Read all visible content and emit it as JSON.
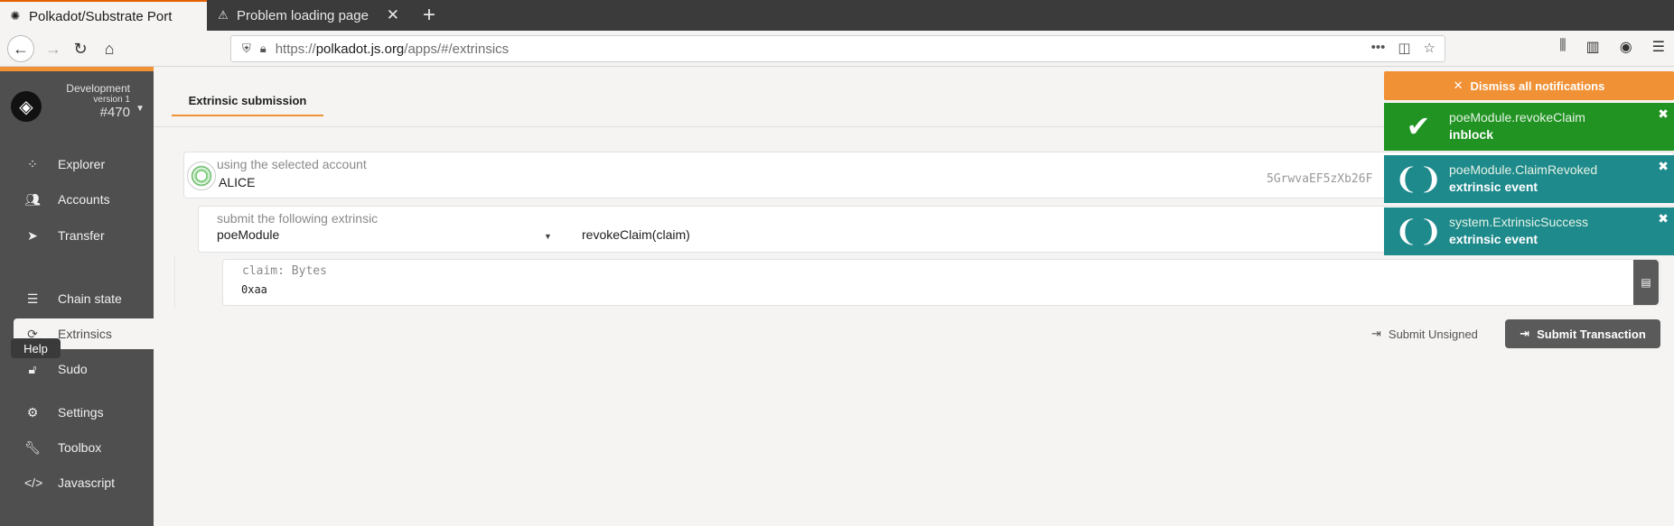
{
  "browser": {
    "tabs": [
      {
        "title": "Polkadot/Substrate Port",
        "icon": "polkadot-favicon",
        "active": true
      },
      {
        "title": "Problem loading page",
        "icon": "warning-icon",
        "active": false
      }
    ],
    "url": {
      "host_prefix": "https://",
      "host": "polkadot.js.org",
      "path": "/apps/#/extrinsics"
    }
  },
  "sidebar": {
    "chain": {
      "name": "Development",
      "version": "version 1",
      "block": "#470"
    },
    "items": [
      {
        "label": "Explorer",
        "icon": "explorer-icon"
      },
      {
        "label": "Accounts",
        "icon": "users-icon"
      },
      {
        "label": "Transfer",
        "icon": "send-icon"
      },
      {
        "label": "Chain state",
        "icon": "database-icon"
      },
      {
        "label": "Extrinsics",
        "icon": "sync-icon"
      },
      {
        "label": "Sudo",
        "icon": "unlock-icon"
      },
      {
        "label": "Settings",
        "icon": "cogs-icon"
      },
      {
        "label": "Toolbox",
        "icon": "wrench-icon"
      },
      {
        "label": "Javascript",
        "icon": "code-icon"
      }
    ],
    "active_item": "Extrinsics",
    "help_tooltip": "Help"
  },
  "main": {
    "tab": "Extrinsic submission",
    "account": {
      "label": "using the selected account",
      "name": "ALICE",
      "address": "5GrwvaEF5zXb26F"
    },
    "extrinsic": {
      "label": "submit the following extrinsic",
      "module": "poeModule",
      "method": "revokeClaim(claim)"
    },
    "param": {
      "label": "claim: Bytes",
      "value": "0xaa"
    },
    "buttons": {
      "unsigned": "Submit Unsigned",
      "submit": "Submit Transaction"
    }
  },
  "notifications": {
    "dismiss_label": "Dismiss all notifications",
    "items": [
      {
        "title": "poeModule.revokeClaim",
        "status": "inblock",
        "color": "#219322",
        "icon": "check-icon"
      },
      {
        "title": "poeModule.ClaimRevoked",
        "status": "extrinsic event",
        "color": "#1e8a8c",
        "icon": "listening-icon"
      },
      {
        "title": "system.ExtrinsicSuccess",
        "status": "extrinsic event",
        "color": "#1e8a8c",
        "icon": "listening-icon"
      }
    ]
  },
  "colors": {
    "accent": "#f19135",
    "sidebar": "#4f4f4f"
  }
}
